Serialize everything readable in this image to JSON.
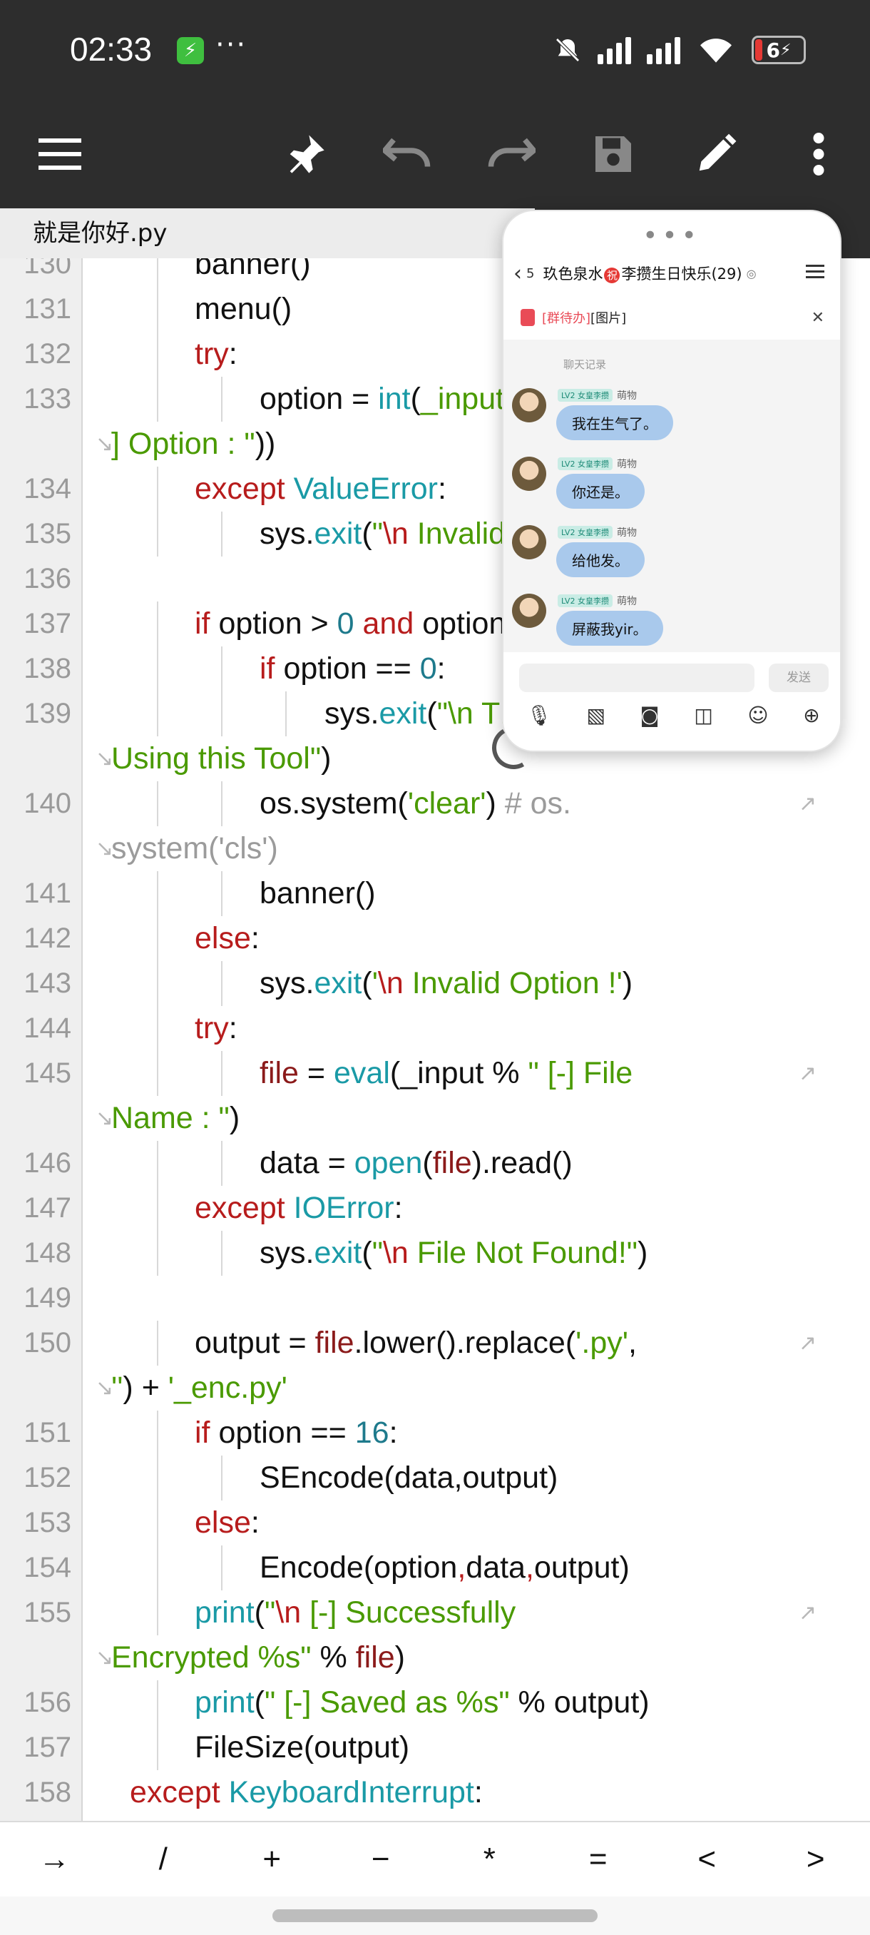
{
  "status": {
    "time": "02:33",
    "battery": "6",
    "dots": "···"
  },
  "toolbar": {
    "icons": [
      "menu-icon",
      "pin-icon",
      "undo-icon",
      "redo-icon",
      "save-icon",
      "edit-icon",
      "more-icon"
    ]
  },
  "tab": {
    "filename": "就是你好.py"
  },
  "code_lines": [
    {
      "n": "130",
      "html": "banner()",
      "indent": 2,
      "partial": true
    },
    {
      "n": "131",
      "html": "menu()",
      "indent": 2
    },
    {
      "n": "132",
      "html": "<span class='kw'>try</span>:",
      "indent": 2
    },
    {
      "n": "133",
      "html": "option = <span class='fn'>int</span>(<span class='st'>_input % \" [-] Choose an</span>",
      "indent": 3
    },
    {
      "n": "",
      "html": "<span class='st'>] Option : \"</span>))",
      "indent": 0,
      "wrap": true
    },
    {
      "n": "134",
      "html": "<span class='kw'>except</span> <span class='fn'>ValueError</span>:",
      "indent": 2
    },
    {
      "n": "135",
      "html": "sys.<span class='fn'>exit</span>(<span class='st'>\"</span><span class='kw'>\\n</span> <span class='st'>Invalid Option !\"</span>)",
      "indent": 3
    },
    {
      "n": "136",
      "html": "",
      "indent": 0
    },
    {
      "n": "137",
      "html": "<span class='kw'>if</span> option &gt; <span class='nm'>0</span> <span class='kw'>and</span> option &lt;= <span class='nm'>16</span>:",
      "indent": 2
    },
    {
      "n": "138",
      "html": "<span class='kw'>if</span> option == <span class='nm'>0</span>:",
      "indent": 3
    },
    {
      "n": "139",
      "html": "sys.<span class='fn'>exit</span>(<span class='st'>\"\\n Thanks For</span>",
      "indent": 4
    },
    {
      "n": "",
      "html": "<span class='st'>Using this Tool\"</span>)",
      "indent": 0,
      "wrap": true
    },
    {
      "n": "140",
      "html": "os.system(<span class='st'>'clear'</span>) <span class='cm'># os.</span>",
      "indent": 3,
      "wrapEnd": true
    },
    {
      "n": "",
      "html": "<span class='cm'>system('cls')</span>",
      "indent": 0,
      "wrap": true
    },
    {
      "n": "141",
      "html": "banner()",
      "indent": 3
    },
    {
      "n": "142",
      "html": "<span class='kw'>else</span>:",
      "indent": 2
    },
    {
      "n": "143",
      "html": "sys.<span class='fn'>exit</span>(<span class='st'>'</span><span class='kw'>\\n</span> <span class='st'>Invalid Option !'</span>)",
      "indent": 3
    },
    {
      "n": "144",
      "html": "<span class='kw'>try</span>:",
      "indent": 2
    },
    {
      "n": "145",
      "html": "<span class='vr'>file</span> = <span class='fn'>eval</span>(_input % <span class='st'>\" [-] File</span>",
      "indent": 3,
      "wrapEnd": true
    },
    {
      "n": "",
      "html": "<span class='st'>Name : \"</span>)",
      "indent": 0,
      "wrap": true
    },
    {
      "n": "146",
      "html": "data = <span class='fn'>open</span>(<span class='vr'>file</span>).read()",
      "indent": 3
    },
    {
      "n": "147",
      "html": "<span class='kw'>except</span> <span class='fn'>IOError</span>:",
      "indent": 2
    },
    {
      "n": "148",
      "html": "sys.<span class='fn'>exit</span>(<span class='st'>\"</span><span class='kw'>\\n</span> <span class='st'>File Not Found!\"</span>)",
      "indent": 3
    },
    {
      "n": "149",
      "html": "",
      "indent": 0
    },
    {
      "n": "150",
      "html": "output = <span class='vr'>file</span>.lower().replace(<span class='st'>'.py'</span>,",
      "indent": 2,
      "wrapEnd": true
    },
    {
      "n": "",
      "html": "<span class='st'>''</span>) + <span class='st'>'_enc.py'</span>",
      "indent": 0,
      "wrap": true
    },
    {
      "n": "151",
      "html": "<span class='kw'>if</span> option == <span class='nm'>16</span>:",
      "indent": 2
    },
    {
      "n": "152",
      "html": "SEncode(data,output)",
      "indent": 3
    },
    {
      "n": "153",
      "html": "<span class='kw'>else</span>:",
      "indent": 2
    },
    {
      "n": "154",
      "html": "Encode(option<span class='kw'>,</span>data<span class='kw'>,</span>output)",
      "indent": 3
    },
    {
      "n": "155",
      "html": "<span class='fn'>print</span>(<span class='st'>\"</span><span class='kw'>\\n</span> <span class='st'>[-] Successfully</span>",
      "indent": 2,
      "wrapEnd": true
    },
    {
      "n": "",
      "html": "<span class='st'>Encrypted %s\"</span> % <span class='vr'>file</span>)",
      "indent": 0,
      "wrap": true
    },
    {
      "n": "156",
      "html": "<span class='fn'>print</span>(<span class='st'>\" [-] Saved as %s\"</span> % output)",
      "indent": 2
    },
    {
      "n": "157",
      "html": "FileSize(output)",
      "indent": 2
    },
    {
      "n": "158",
      "html": "<span class='kw'>except</span> <span class='fn'>KeyboardInterrupt</span>:",
      "indent": 1
    }
  ],
  "chat": {
    "handle": "•••",
    "unread": "5",
    "title_part1": "玖色泉水",
    "title_circle": "祝",
    "title_part2": "李攒生日快乐(29)",
    "notice_tag": "[群待办]",
    "notice_text": "[图片]",
    "history": "聊天记录",
    "level": "LV2 女皇李攒",
    "sender": "萌物",
    "messages": [
      "我在生气了。",
      "你还是。",
      "给他发。",
      "屏蔽我yir。"
    ],
    "send_label": "发送",
    "tool_icons": [
      "mic-icon",
      "image-icon",
      "camera-icon",
      "sticker-icon",
      "emoji-icon",
      "plus-icon"
    ]
  },
  "symbols": [
    "→",
    "/",
    "+",
    "−",
    "*",
    "=",
    "<",
    ">"
  ]
}
